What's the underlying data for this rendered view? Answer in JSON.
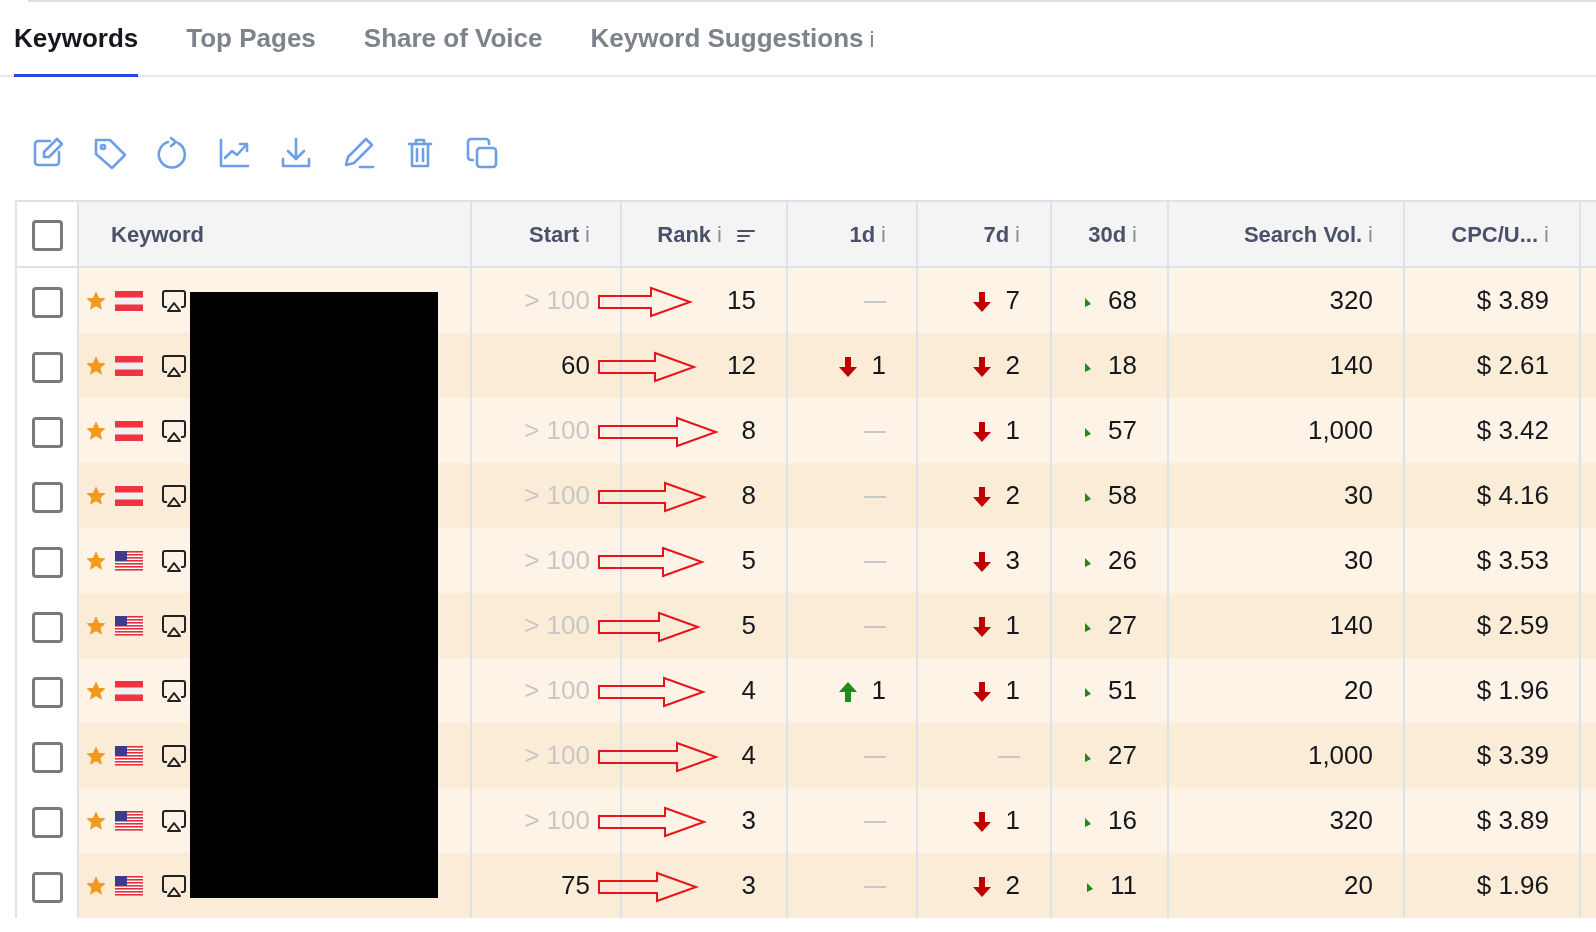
{
  "tabs": [
    {
      "label": "Keywords",
      "selected": true
    },
    {
      "label": "Top Pages",
      "selected": false
    },
    {
      "label": "Share of Voice",
      "selected": false
    },
    {
      "label": "Keyword Suggestions",
      "info": "i",
      "selected": false
    }
  ],
  "table": {
    "select_all": {
      "checked": false
    },
    "columns": [
      {
        "label": "Keyword"
      },
      {
        "label": "Start",
        "info": "i"
      },
      {
        "label": "Rank",
        "info": "i",
        "sortable": true
      },
      {
        "label": "1d",
        "info": "i"
      },
      {
        "label": "7d",
        "info": "i"
      },
      {
        "label": "30d",
        "info": "i"
      },
      {
        "label": "Search Vol.",
        "info": "i"
      },
      {
        "label": "CPC/U...",
        "info": "i"
      }
    ],
    "rows": [
      {
        "checked": false,
        "starred": true,
        "flag": {
          "kind": "at"
        },
        "start": "> 100",
        "start_muted": true,
        "rank": "15",
        "d1": {
          "kind": "none"
        },
        "d7": {
          "kind": "down",
          "value": "7"
        },
        "d30": "68",
        "volume": "320",
        "cpc": "$ 3.89"
      },
      {
        "checked": false,
        "starred": true,
        "flag": {
          "kind": "at"
        },
        "start": "60",
        "start_muted": false,
        "rank": "12",
        "d1": {
          "kind": "down",
          "value": "1"
        },
        "d7": {
          "kind": "down",
          "value": "2"
        },
        "d30": "18",
        "volume": "140",
        "cpc": "$ 2.61"
      },
      {
        "checked": false,
        "starred": true,
        "flag": {
          "kind": "at"
        },
        "start": "> 100",
        "start_muted": true,
        "rank": "8",
        "d1": {
          "kind": "none"
        },
        "d7": {
          "kind": "down",
          "value": "1"
        },
        "d30": "57",
        "volume": "1,000",
        "cpc": "$ 3.42"
      },
      {
        "checked": false,
        "starred": true,
        "flag": {
          "kind": "at"
        },
        "start": "> 100",
        "start_muted": true,
        "rank": "8",
        "d1": {
          "kind": "none"
        },
        "d7": {
          "kind": "down",
          "value": "2"
        },
        "d30": "58",
        "volume": "30",
        "cpc": "$ 4.16"
      },
      {
        "checked": false,
        "starred": true,
        "flag": {
          "kind": "us"
        },
        "start": "> 100",
        "start_muted": true,
        "rank": "5",
        "d1": {
          "kind": "none"
        },
        "d7": {
          "kind": "down",
          "value": "3"
        },
        "d30": "26",
        "volume": "30",
        "cpc": "$ 3.53"
      },
      {
        "checked": false,
        "starred": true,
        "flag": {
          "kind": "us"
        },
        "start": "> 100",
        "start_muted": true,
        "rank": "5",
        "d1": {
          "kind": "none"
        },
        "d7": {
          "kind": "down",
          "value": "1"
        },
        "d30": "27",
        "volume": "140",
        "cpc": "$ 2.59"
      },
      {
        "checked": false,
        "starred": true,
        "flag": {
          "kind": "at"
        },
        "start": "> 100",
        "start_muted": true,
        "rank": "4",
        "d1": {
          "kind": "up",
          "value": "1"
        },
        "d7": {
          "kind": "down",
          "value": "1"
        },
        "d30": "51",
        "volume": "20",
        "cpc": "$ 1.96"
      },
      {
        "checked": false,
        "starred": true,
        "flag": {
          "kind": "us"
        },
        "start": "> 100",
        "start_muted": true,
        "rank": "4",
        "d1": {
          "kind": "none"
        },
        "d7": {
          "kind": "none"
        },
        "d30": "27",
        "volume": "1,000",
        "cpc": "$ 3.39"
      },
      {
        "checked": false,
        "starred": true,
        "flag": {
          "kind": "us"
        },
        "start": "> 100",
        "start_muted": true,
        "rank": "3",
        "d1": {
          "kind": "none"
        },
        "d7": {
          "kind": "down",
          "value": "1"
        },
        "d30": "16",
        "volume": "320",
        "cpc": "$ 3.89"
      },
      {
        "checked": false,
        "starred": true,
        "flag": {
          "kind": "us"
        },
        "start": "75",
        "start_muted": false,
        "rank": "3",
        "d1": {
          "kind": "none"
        },
        "d7": {
          "kind": "down",
          "value": "2"
        },
        "d30": "11",
        "volume": "20",
        "cpc": "$ 1.96"
      }
    ]
  }
}
